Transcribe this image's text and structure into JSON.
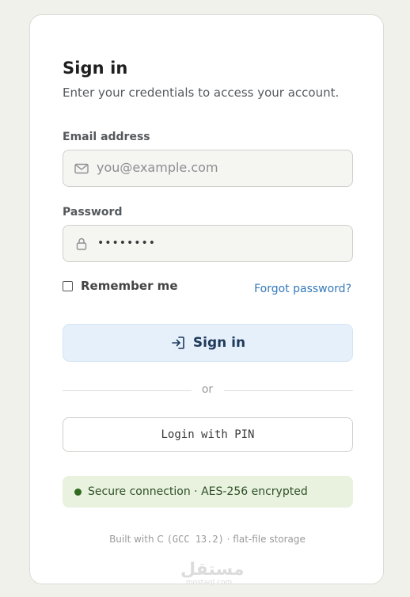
{
  "header": {
    "title": "Sign in",
    "subtitle": "Enter your credentials to access your account."
  },
  "email": {
    "label": "Email address",
    "placeholder": "you@example.com",
    "icon": "mail-icon"
  },
  "password": {
    "label": "Password",
    "value_masked": "••••••••",
    "icon": "lock-icon"
  },
  "remember": {
    "label": "Remember me",
    "checked": false
  },
  "forgot": {
    "label": "Forgot password?"
  },
  "signin_button": {
    "label": "Sign in",
    "icon": "sign-in-icon"
  },
  "divider": {
    "text": "or"
  },
  "pin_button": {
    "label": "Login with PIN"
  },
  "status": {
    "text": "Secure connection · AES-256 encrypted"
  },
  "footer": {
    "prefix": "Built with C",
    "version": "(GCC 13.2)",
    "suffix": "· flat-file storage"
  },
  "watermark": {
    "arabic": "مستقل",
    "latin": "mostaql.com"
  },
  "colors": {
    "accent": "#3479b8",
    "primary_button_bg": "#e5f0fa",
    "secure_bg": "#e8f2df",
    "secure_dot": "#2f6a1e",
    "page_bg": "#f1f1ec"
  }
}
